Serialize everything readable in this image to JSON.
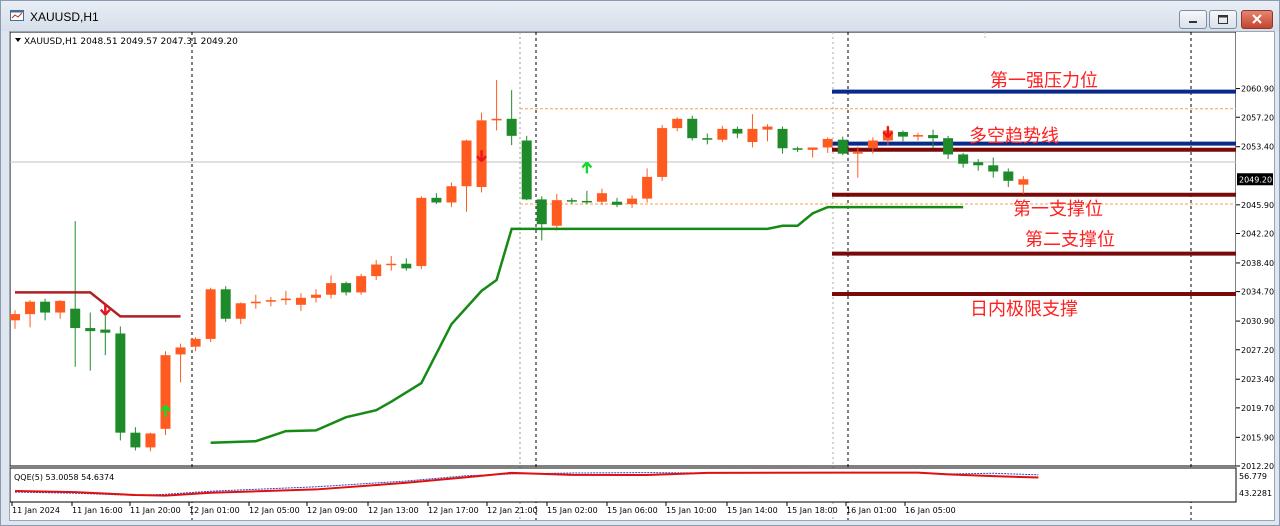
{
  "window": {
    "title": "XAUUSD,H1",
    "controls": [
      "minimize-button",
      "maximize-button",
      "close-button"
    ]
  },
  "chart_data": {
    "type": "candlestick",
    "symbol_header": "XAUUSD,H1  2048.51 2049.57 2047.31 2049.20",
    "current_price": "2049.20",
    "ylim": [
      2012.2,
      2064.2
    ],
    "y_ticks": [
      "2060.90",
      "2057.20",
      "2053.40",
      "2049.20",
      "2045.90",
      "2042.20",
      "2038.40",
      "2034.70",
      "2030.90",
      "2027.20",
      "2023.40",
      "2019.70",
      "2015.90",
      "2012.20"
    ],
    "x_ticks": [
      "11 Jan 2024",
      "11 Jan 16:00",
      "11 Jan 20:00",
      "12 Jan 01:00",
      "12 Jan 05:00",
      "12 Jan 09:00",
      "12 Jan 13:00",
      "12 Jan 17:00",
      "12 Jan 21:00",
      "15 Jan 02:00",
      "15 Jan 06:00",
      "15 Jan 10:00",
      "15 Jan 14:00",
      "15 Jan 18:00",
      "16 Jan 01:00",
      "16 Jan 05:00"
    ],
    "colors": {
      "bull": "#ff5a1f",
      "bear": "#1f8a2a",
      "level_blue": "#0a2a8a",
      "level_red": "#7a0a0a",
      "label_red": "#ff2020",
      "trail": "#158a15",
      "trail_red": "#b02020"
    },
    "candles": [
      {
        "o": 2031.0,
        "h": 2032.3,
        "l": 2029.9,
        "c": 2031.8
      },
      {
        "o": 2031.8,
        "h": 2033.6,
        "l": 2030.1,
        "c": 2033.4
      },
      {
        "o": 2033.4,
        "h": 2033.8,
        "l": 2031.0,
        "c": 2032.0
      },
      {
        "o": 2032.0,
        "h": 2033.6,
        "l": 2031.2,
        "c": 2033.5
      },
      {
        "o": 2032.5,
        "h": 2043.8,
        "l": 2025.0,
        "c": 2030.0
      },
      {
        "o": 2030.0,
        "h": 2032.0,
        "l": 2024.5,
        "c": 2029.6
      },
      {
        "o": 2029.8,
        "h": 2032.5,
        "l": 2026.5,
        "c": 2029.4
      },
      {
        "o": 2029.3,
        "h": 2030.2,
        "l": 2015.5,
        "c": 2016.5
      },
      {
        "o": 2016.5,
        "h": 2017.2,
        "l": 2014.2,
        "c": 2014.6
      },
      {
        "o": 2014.6,
        "h": 2016.5,
        "l": 2014.1,
        "c": 2016.4
      },
      {
        "o": 2017.0,
        "h": 2027.0,
        "l": 2016.2,
        "c": 2026.5
      },
      {
        "o": 2026.6,
        "h": 2028.0,
        "l": 2023.0,
        "c": 2027.5
      },
      {
        "o": 2027.6,
        "h": 2028.8,
        "l": 2027.0,
        "c": 2028.6
      },
      {
        "o": 2028.6,
        "h": 2035.2,
        "l": 2028.2,
        "c": 2035.0
      },
      {
        "o": 2035.0,
        "h": 2035.4,
        "l": 2030.8,
        "c": 2031.2
      },
      {
        "o": 2031.2,
        "h": 2033.3,
        "l": 2030.5,
        "c": 2033.2
      },
      {
        "o": 2033.2,
        "h": 2034.3,
        "l": 2032.5,
        "c": 2033.4
      },
      {
        "o": 2033.4,
        "h": 2034.0,
        "l": 2032.8,
        "c": 2033.6
      },
      {
        "o": 2033.6,
        "h": 2034.8,
        "l": 2033.0,
        "c": 2033.8
      },
      {
        "o": 2033.0,
        "h": 2034.5,
        "l": 2032.2,
        "c": 2033.9
      },
      {
        "o": 2033.9,
        "h": 2035.0,
        "l": 2033.3,
        "c": 2034.3
      },
      {
        "o": 2034.3,
        "h": 2036.8,
        "l": 2033.8,
        "c": 2035.8
      },
      {
        "o": 2035.8,
        "h": 2036.0,
        "l": 2034.2,
        "c": 2034.6
      },
      {
        "o": 2034.6,
        "h": 2037.0,
        "l": 2034.3,
        "c": 2036.7
      },
      {
        "o": 2036.7,
        "h": 2038.8,
        "l": 2036.2,
        "c": 2038.2
      },
      {
        "o": 2038.2,
        "h": 2039.3,
        "l": 2037.4,
        "c": 2038.3
      },
      {
        "o": 2038.3,
        "h": 2039.0,
        "l": 2037.4,
        "c": 2037.7
      },
      {
        "o": 2038.0,
        "h": 2047.0,
        "l": 2037.6,
        "c": 2046.8
      },
      {
        "o": 2046.8,
        "h": 2047.4,
        "l": 2046.0,
        "c": 2046.2
      },
      {
        "o": 2046.2,
        "h": 2048.8,
        "l": 2045.6,
        "c": 2048.3
      },
      {
        "o": 2048.3,
        "h": 2054.3,
        "l": 2045.0,
        "c": 2054.2
      },
      {
        "o": 2048.2,
        "h": 2057.8,
        "l": 2047.5,
        "c": 2056.8
      },
      {
        "o": 2056.8,
        "h": 2062.0,
        "l": 2055.5,
        "c": 2057.0
      },
      {
        "o": 2057.0,
        "h": 2060.7,
        "l": 2053.6,
        "c": 2054.8
      },
      {
        "o": 2054.2,
        "h": 2054.8,
        "l": 2046.5,
        "c": 2046.6
      },
      {
        "o": 2046.6,
        "h": 2047.0,
        "l": 2041.3,
        "c": 2043.4
      },
      {
        "o": 2043.2,
        "h": 2047.3,
        "l": 2042.6,
        "c": 2046.5
      },
      {
        "o": 2046.5,
        "h": 2046.8,
        "l": 2046.0,
        "c": 2046.4
      },
      {
        "o": 2046.4,
        "h": 2047.7,
        "l": 2046.0,
        "c": 2046.3
      },
      {
        "o": 2046.3,
        "h": 2048.0,
        "l": 2045.9,
        "c": 2047.4
      },
      {
        "o": 2046.3,
        "h": 2046.8,
        "l": 2045.6,
        "c": 2045.9
      },
      {
        "o": 2046.0,
        "h": 2047.1,
        "l": 2045.5,
        "c": 2046.7
      },
      {
        "o": 2046.7,
        "h": 2050.6,
        "l": 2046.2,
        "c": 2049.5
      },
      {
        "o": 2049.5,
        "h": 2056.2,
        "l": 2049.0,
        "c": 2055.8
      },
      {
        "o": 2055.8,
        "h": 2057.2,
        "l": 2055.4,
        "c": 2057.0
      },
      {
        "o": 2057.0,
        "h": 2057.4,
        "l": 2054.2,
        "c": 2054.5
      },
      {
        "o": 2054.5,
        "h": 2055.1,
        "l": 2053.7,
        "c": 2054.3
      },
      {
        "o": 2054.3,
        "h": 2056.1,
        "l": 2054.0,
        "c": 2055.7
      },
      {
        "o": 2055.7,
        "h": 2056.0,
        "l": 2054.5,
        "c": 2055.1
      },
      {
        "o": 2054.0,
        "h": 2057.6,
        "l": 2053.3,
        "c": 2055.7
      },
      {
        "o": 2055.6,
        "h": 2056.3,
        "l": 2054.1,
        "c": 2056.0
      },
      {
        "o": 2055.7,
        "h": 2056.0,
        "l": 2052.5,
        "c": 2053.2
      },
      {
        "o": 2053.2,
        "h": 2053.4,
        "l": 2052.7,
        "c": 2053.0
      },
      {
        "o": 2053.0,
        "h": 2053.3,
        "l": 2052.0,
        "c": 2053.3
      },
      {
        "o": 2053.3,
        "h": 2054.6,
        "l": 2052.6,
        "c": 2054.4
      },
      {
        "o": 2054.3,
        "h": 2054.7,
        "l": 2052.3,
        "c": 2052.5
      },
      {
        "o": 2052.5,
        "h": 2053.4,
        "l": 2049.4,
        "c": 2052.7
      },
      {
        "o": 2053.2,
        "h": 2054.6,
        "l": 2052.5,
        "c": 2054.2
      },
      {
        "o": 2054.2,
        "h": 2056.1,
        "l": 2053.6,
        "c": 2055.5
      },
      {
        "o": 2055.3,
        "h": 2055.5,
        "l": 2054.1,
        "c": 2054.7
      },
      {
        "o": 2054.7,
        "h": 2055.2,
        "l": 2054.2,
        "c": 2054.9
      },
      {
        "o": 2054.9,
        "h": 2055.6,
        "l": 2053.2,
        "c": 2054.5
      },
      {
        "o": 2054.5,
        "h": 2054.8,
        "l": 2051.8,
        "c": 2052.4
      },
      {
        "o": 2052.4,
        "h": 2052.6,
        "l": 2050.7,
        "c": 2051.2
      },
      {
        "o": 2051.4,
        "h": 2051.8,
        "l": 2050.3,
        "c": 2051.0
      },
      {
        "o": 2051.0,
        "h": 2052.0,
        "l": 2049.4,
        "c": 2050.2
      },
      {
        "o": 2050.2,
        "h": 2050.6,
        "l": 2048.2,
        "c": 2049.0
      },
      {
        "o": 2048.5,
        "h": 2049.6,
        "l": 2047.3,
        "c": 2049.2
      }
    ],
    "trail_line": [
      [
        13,
        2015.2
      ],
      [
        16,
        2015.4
      ],
      [
        18,
        2016.7
      ],
      [
        20,
        2016.8
      ],
      [
        22,
        2018.5
      ],
      [
        24,
        2019.4
      ],
      [
        25,
        2020.5
      ],
      [
        27,
        2022.9
      ],
      [
        29,
        2030.5
      ],
      [
        31,
        2034.8
      ],
      [
        32,
        2036.2
      ],
      [
        33,
        2042.8
      ],
      [
        34,
        2042.8
      ],
      [
        50,
        2042.8
      ],
      [
        51,
        2043.2
      ],
      [
        52,
        2043.2
      ],
      [
        53,
        2044.8
      ],
      [
        54,
        2045.6
      ],
      [
        63,
        2045.6
      ]
    ],
    "trail_red": [
      [
        0,
        2034.6
      ],
      [
        5,
        2034.6
      ],
      [
        7,
        2031.5
      ],
      [
        11,
        2031.5
      ]
    ],
    "arrows": [
      {
        "dir": "down",
        "index": 6,
        "price": 2032.5
      },
      {
        "dir": "up",
        "index": 10,
        "price": 2019.2
      },
      {
        "dir": "down",
        "index": 31,
        "price": 2052.3
      },
      {
        "dir": "up",
        "index": 38,
        "price": 2050.6
      },
      {
        "dir": "down",
        "index": 58,
        "price": 2055.4
      }
    ],
    "levels": [
      {
        "label": "第一强压力位",
        "price": 2060.5,
        "color": "blue"
      },
      {
        "label": "",
        "price": 2053.8,
        "color": "blue"
      },
      {
        "label": "多空趋势线",
        "price": 2053.0,
        "color": "red"
      },
      {
        "label": "第一支撑位",
        "price": 2047.2,
        "color": "red"
      },
      {
        "label": "第二支撑位",
        "price": 2039.6,
        "color": "red"
      },
      {
        "label": "日内极限支撑",
        "price": 2034.4,
        "color": "red"
      }
    ],
    "dotted_levels": [
      2058.3,
      2046.0
    ],
    "qqe": {
      "label": "QQE(5) 53.0058 54.6374",
      "y_ticks": [
        "56.779",
        "43.2281"
      ],
      "main": [
        [
          0,
          47.3
        ],
        [
          4,
          46.8
        ],
        [
          8,
          45.5
        ],
        [
          10,
          45.2
        ],
        [
          13,
          46.5
        ],
        [
          20,
          48.0
        ],
        [
          26,
          51.0
        ],
        [
          30,
          53.5
        ],
        [
          33,
          55.5
        ],
        [
          37,
          54.6
        ],
        [
          42,
          54.5
        ],
        [
          46,
          55.5
        ],
        [
          55,
          55.6
        ],
        [
          60,
          55.6
        ],
        [
          62,
          54.8
        ],
        [
          65,
          54.0
        ],
        [
          68,
          53.4
        ]
      ],
      "signal": [
        [
          0,
          46.8
        ],
        [
          4,
          46.3
        ],
        [
          8,
          45.3
        ],
        [
          10,
          45.8
        ],
        [
          13,
          47.2
        ],
        [
          20,
          49.2
        ],
        [
          26,
          51.8
        ],
        [
          30,
          54.2
        ],
        [
          33,
          55.0
        ],
        [
          37,
          55.4
        ],
        [
          42,
          55.6
        ],
        [
          46,
          55.4
        ],
        [
          55,
          55.4
        ],
        [
          60,
          55.4
        ],
        [
          62,
          55.0
        ],
        [
          65,
          55.3
        ],
        [
          68,
          54.6
        ]
      ]
    }
  }
}
